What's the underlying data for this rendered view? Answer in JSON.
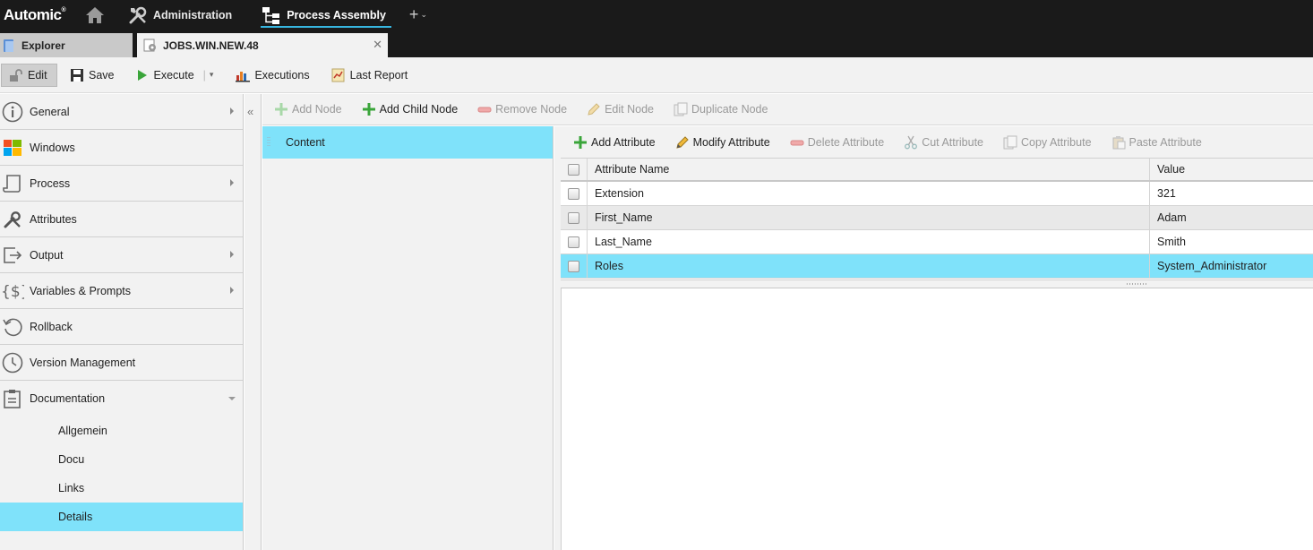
{
  "app": {
    "brand": "Automic",
    "brand_mark": "®"
  },
  "topnav": {
    "administration": "Administration",
    "process_assembly": "Process Assembly",
    "add": "+",
    "add_caret": "⌄"
  },
  "tabs": {
    "explorer": "Explorer",
    "job": "JOBS.WIN.NEW.48",
    "close": "✕"
  },
  "toolbar": {
    "edit": "Edit",
    "save": "Save",
    "execute": "Execute",
    "separator": "|",
    "caret": "▾",
    "executions": "Executions",
    "last_report": "Last Report"
  },
  "sidebar": {
    "items": [
      {
        "label": "General"
      },
      {
        "label": "Windows"
      },
      {
        "label": "Process"
      },
      {
        "label": "Attributes"
      },
      {
        "label": "Output"
      },
      {
        "label": "Variables & Prompts"
      },
      {
        "label": "Rollback"
      },
      {
        "label": "Version Management"
      },
      {
        "label": "Documentation"
      }
    ],
    "subitems": [
      {
        "label": "Allgemein"
      },
      {
        "label": "Docu"
      },
      {
        "label": "Links"
      },
      {
        "label": "Details"
      }
    ],
    "active_subitem": "Details"
  },
  "collapse": "«",
  "nodebar": {
    "add_node": "Add Node",
    "add_child_node": "Add Child Node",
    "remove_node": "Remove Node",
    "edit_node": "Edit Node",
    "duplicate_node": "Duplicate Node"
  },
  "tree": {
    "nodes": [
      {
        "label": "Content"
      }
    ]
  },
  "attrbar": {
    "add_attribute": "Add Attribute",
    "modify_attribute": "Modify Attribute",
    "delete_attribute": "Delete Attribute",
    "cut_attribute": "Cut Attribute",
    "copy_attribute": "Copy Attribute",
    "paste_attribute": "Paste Attribute"
  },
  "grid": {
    "columns": {
      "name": "Attribute Name",
      "value": "Value"
    },
    "rows": [
      {
        "name": "Extension",
        "value": "321"
      },
      {
        "name": "First_Name",
        "value": "Adam"
      },
      {
        "name": "Last_Name",
        "value": "Smith"
      },
      {
        "name": "Roles",
        "value": "System_Administrator"
      }
    ],
    "selected_row": "Roles"
  },
  "colors": {
    "accent": "#37b6e0",
    "selection": "#7fe2fa",
    "topbar": "#1a1a1a"
  }
}
